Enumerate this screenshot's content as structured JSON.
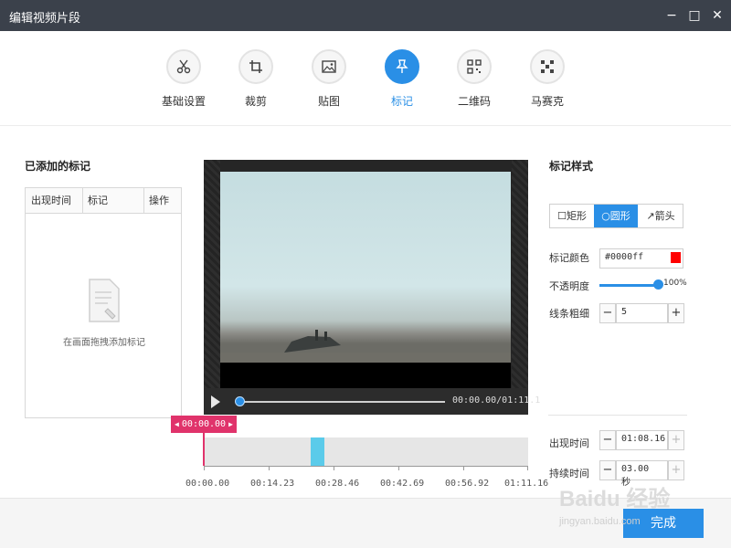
{
  "window": {
    "title": "编辑视频片段",
    "minimize": "−",
    "maximize": "□",
    "close": "✕"
  },
  "toolbar": {
    "items": [
      {
        "label": "基础设置",
        "icon": "scissors-icon"
      },
      {
        "label": "裁剪",
        "icon": "crop-icon"
      },
      {
        "label": "贴图",
        "icon": "image-icon"
      },
      {
        "label": "标记",
        "icon": "pin-icon",
        "active": true
      },
      {
        "label": "二维码",
        "icon": "qrcode-icon"
      },
      {
        "label": "马赛克",
        "icon": "mosaic-icon"
      }
    ]
  },
  "marks_panel": {
    "title": "已添加的标记",
    "columns": [
      "出现时间",
      "标记",
      "操作"
    ],
    "empty_hint": "在画面拖拽添加标记"
  },
  "player": {
    "time": "00:00.00/01:11.1",
    "progress": 0
  },
  "timeline": {
    "marker_time": "00:00.00",
    "segment_start_fraction": 0.33,
    "segment_width_fraction": 0.04,
    "ticks": [
      "00:00.00",
      "00:14.23",
      "00:28.46",
      "00:42.69",
      "00:56.92",
      "01:11.16"
    ]
  },
  "style_panel": {
    "title": "标记样式",
    "shapes": [
      {
        "label": "矩形",
        "icon": "rectangle-icon"
      },
      {
        "label": "圆形",
        "icon": "circle-icon",
        "active": true
      },
      {
        "label": "箭头",
        "icon": "arrow-icon"
      }
    ],
    "color_label": "标记颜色",
    "color_value": "#0000ff",
    "swatch_color": "#ff0000",
    "opacity_label": "不透明度",
    "opacity_value": "100%",
    "opacity_fraction": 1.0,
    "line_label": "线条粗细",
    "line_value": "5",
    "appear_label": "出现时间",
    "appear_value": "01:08.16",
    "duration_label": "持续时间",
    "duration_value": "03.00 秒"
  },
  "footer": {
    "done_label": "完成"
  },
  "watermark": {
    "brand": "Baidu 经验",
    "url": "jingyan.baidu.com"
  },
  "colors": {
    "accent": "#2a8fe6",
    "marker": "#e0336b",
    "segment": "#5bcbea",
    "titlebar": "#3b414b"
  }
}
